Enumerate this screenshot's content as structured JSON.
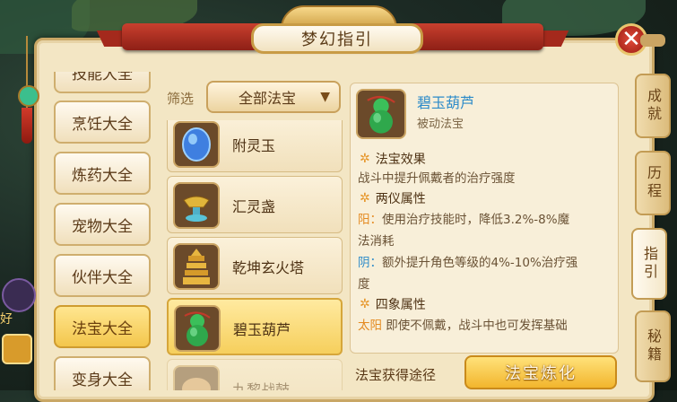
{
  "header": {
    "title": "梦幻指引"
  },
  "categories": [
    {
      "label": "技能大全",
      "active": false
    },
    {
      "label": "烹饪大全",
      "active": false
    },
    {
      "label": "炼药大全",
      "active": false
    },
    {
      "label": "宠物大全",
      "active": false
    },
    {
      "label": "伙伴大全",
      "active": false
    },
    {
      "label": "法宝大全",
      "active": true
    },
    {
      "label": "变身大全",
      "active": false
    }
  ],
  "filter": {
    "label": "筛选",
    "selected": "全部法宝"
  },
  "list": [
    {
      "name": "附灵玉",
      "icon": "blue-jade-icon"
    },
    {
      "name": "汇灵盏",
      "icon": "lamp-icon"
    },
    {
      "name": "乾坤玄火塔",
      "icon": "pagoda-icon"
    },
    {
      "name": "碧玉葫芦",
      "icon": "gourd-icon",
      "active": true
    },
    {
      "name": "九黎战鼓",
      "icon": "drum-icon",
      "faded": true
    }
  ],
  "detail": {
    "name": "碧玉葫芦",
    "type": "被动法宝",
    "sections": [
      {
        "title": "法宝效果",
        "lines": [
          "战斗中提升佩戴者的治疗强度"
        ]
      },
      {
        "title": "两仪属性",
        "yang_key": "阳：",
        "yang_line1": "使用治疗技能时，降低3.2%-8%魔",
        "yang_line2": "法消耗",
        "yin_key": "阴：",
        "yin_line1": "额外提升角色等级的4%-10%治疗强",
        "yin_line2": "度"
      },
      {
        "title": "四象属性",
        "taiyang_key": "太阳",
        "taiyang_line": "即使不佩戴，战斗中也可发挥基础"
      }
    ]
  },
  "footer": {
    "label": "法宝获得途径",
    "button": "法宝炼化"
  },
  "side_tabs": [
    "成就",
    "历程",
    "指引",
    "秘籍"
  ],
  "edge": {
    "text": "好"
  },
  "colors": {
    "accent": "#f3c64c",
    "ribbon": "#b8321f",
    "link_blue": "#2d8bc9",
    "key_orange": "#e48a21"
  }
}
